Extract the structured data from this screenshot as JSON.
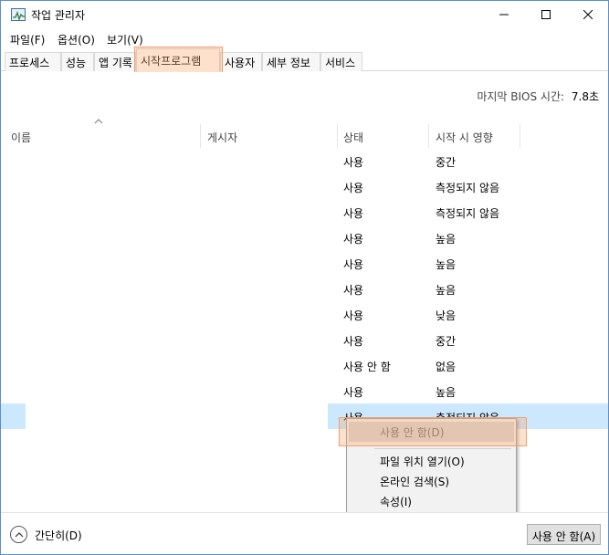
{
  "window": {
    "title": "작업 관리자",
    "controls": {
      "minimize": "—",
      "maximize": "☐",
      "close": "✕"
    }
  },
  "menu": [
    "파일(F)",
    "옵션(O)",
    "보기(V)"
  ],
  "tabs": [
    {
      "label": "프로세스"
    },
    {
      "label": "성능"
    },
    {
      "label": "앱 기록"
    },
    {
      "label": "시작프로그램"
    },
    {
      "label": "사용자"
    },
    {
      "label": "세부 정보"
    },
    {
      "label": "서비스"
    }
  ],
  "bios": {
    "label": "마지막 BIOS 시간:",
    "value": "7.8초"
  },
  "columns": {
    "name": "이름",
    "publisher": "게시자",
    "status": "상태",
    "impact": "시작 시 영향"
  },
  "rows": [
    {
      "status": "사용",
      "impact": "중간"
    },
    {
      "status": "사용",
      "impact": "측정되지 않음"
    },
    {
      "status": "사용",
      "impact": "측정되지 않음"
    },
    {
      "status": "사용",
      "impact": "높음"
    },
    {
      "status": "사용",
      "impact": "높음"
    },
    {
      "status": "사용",
      "impact": "높음"
    },
    {
      "status": "사용",
      "impact": "낮음"
    },
    {
      "status": "사용",
      "impact": "중간"
    },
    {
      "status": "사용 안 함",
      "impact": "없음"
    },
    {
      "status": "사용",
      "impact": "높음"
    },
    {
      "status": "사용",
      "impact": "측정되지 않음"
    }
  ],
  "context_menu": {
    "items": [
      "사용 안 함(D)",
      "파일 위치 열기(O)",
      "온라인 검색(S)",
      "속성(I)"
    ]
  },
  "footer": {
    "fewer_details": "간단히(D)",
    "disable_button": "사용 안 함(A)"
  }
}
